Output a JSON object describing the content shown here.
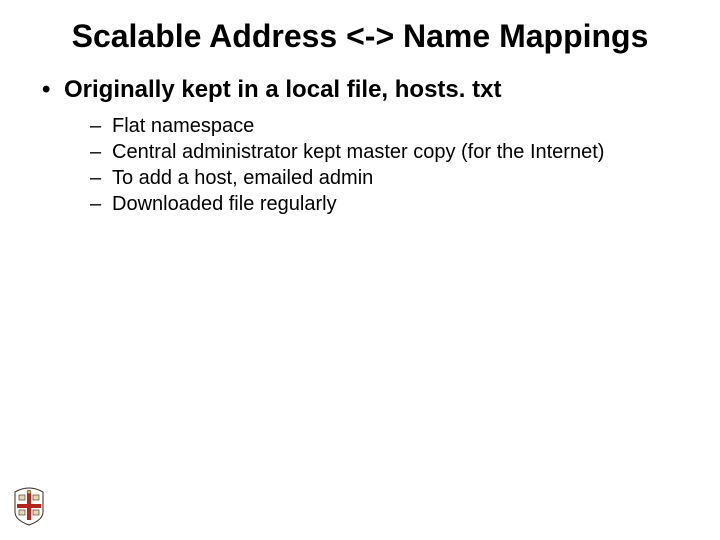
{
  "title": "Scalable Address <-> Name Mappings",
  "bullets": [
    {
      "text": "Originally kept in a local file, hosts. txt",
      "sub": [
        "Flat namespace",
        "Central administrator kept master copy (for the Internet)",
        "To add a host, emailed admin",
        "Downloaded file regularly"
      ]
    }
  ]
}
